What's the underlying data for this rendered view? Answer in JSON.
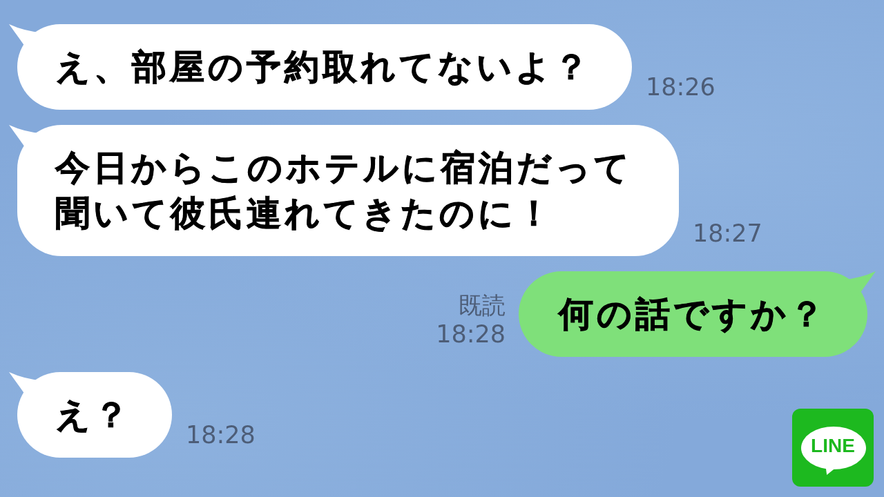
{
  "chat": {
    "messages": [
      {
        "kind": "incoming",
        "text": "え、部屋の予約取れてないよ？",
        "time": "18:26"
      },
      {
        "kind": "incoming",
        "text": "今日からこのホテルに宿泊だって聞いて彼氏連れてきたのに！",
        "time": "18:27"
      },
      {
        "kind": "outgoing",
        "text": "何の話ですか？",
        "read_receipt": "既読",
        "time": "18:28"
      },
      {
        "kind": "incoming",
        "text": "え？",
        "time": "18:28"
      }
    ]
  },
  "logo": {
    "text": "LINE"
  }
}
